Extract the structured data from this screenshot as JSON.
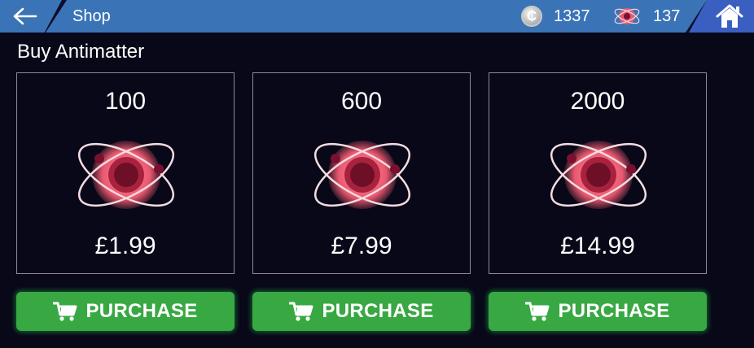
{
  "header": {
    "title": "Shop",
    "back_icon": "arrow-left-icon",
    "home_icon": "home-icon",
    "colors": {
      "bar": "#3a74b6",
      "home": "#3a5fc0"
    }
  },
  "wallet": {
    "coins": {
      "icon": "coin-icon",
      "symbol": "₵",
      "amount": "1337"
    },
    "antimatter": {
      "icon": "antimatter-atom-icon",
      "amount": "137"
    }
  },
  "section": {
    "heading": "Buy Antimatter"
  },
  "offers": [
    {
      "amount": "100",
      "price": "£1.99",
      "button_label": "PURCHASE"
    },
    {
      "amount": "600",
      "price": "£7.99",
      "button_label": "PURCHASE"
    },
    {
      "amount": "2000",
      "price": "£14.99",
      "button_label": "PURCHASE"
    }
  ],
  "colors": {
    "background": "#080818",
    "button": "#38a843",
    "atom": "#e05a72"
  }
}
